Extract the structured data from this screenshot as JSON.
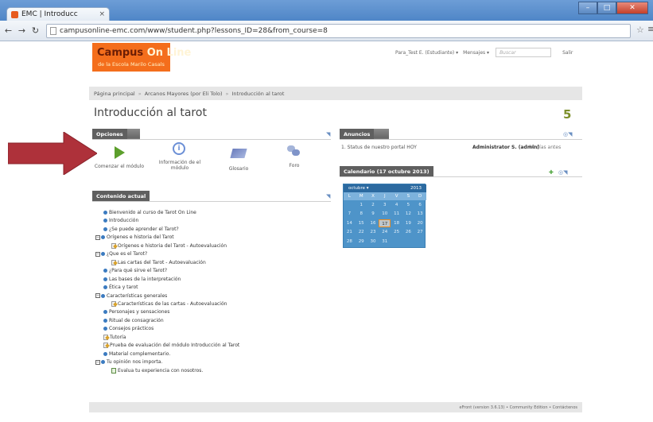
{
  "browser": {
    "tab_title": "EMC | Introducc",
    "url": "campusonline-emc.com/www/student.php?lessons_ID=28&from_course=8"
  },
  "header": {
    "logo_title_a": "Campus",
    "logo_title_b": " On Line",
    "logo_subtitle": "de la Escola Marilo Casals",
    "user": "Para_Test E. (Estudiante) ▾",
    "messages": "Mensajes ▾",
    "search_placeholder": "Buscar",
    "logout": "Salir"
  },
  "breadcrumb": [
    "Página principal",
    "Arcanos Mayores (por Eli Tolo)",
    "Introducción al tarot"
  ],
  "page_title": "Introducción al tarot",
  "options_panel": {
    "title": "Opciones",
    "items": [
      {
        "label": "Comenzar el módulo",
        "icon": "play-icon"
      },
      {
        "label": "Información de el módulo",
        "icon": "info-icon"
      },
      {
        "label": "Glosario",
        "icon": "glossary-icon"
      },
      {
        "label": "Foro",
        "icon": "forum-icon"
      }
    ]
  },
  "content_panel": {
    "title": "Contenido actual",
    "tree": [
      {
        "label": "Bienvenido al curso de Tarot On Line",
        "icon": "bullet",
        "level": 0
      },
      {
        "label": "Introducción",
        "icon": "bullet",
        "level": 0
      },
      {
        "label": "¿Se puede aprender el Tarot?",
        "icon": "bullet",
        "level": 0
      },
      {
        "label": "Orígenes e historia del Tarot",
        "icon": "bullet",
        "level": 0,
        "toggle": "−"
      },
      {
        "label": "Orígenes e historia del Tarot - Autoevaluación",
        "icon": "doc",
        "level": 1
      },
      {
        "label": "¿Que es el Tarot?",
        "icon": "bullet",
        "level": 0,
        "toggle": "−"
      },
      {
        "label": "Las cartas del Tarot - Autoevaluación",
        "icon": "doc",
        "level": 1
      },
      {
        "label": "¿Para qué sirve el Tarot?",
        "icon": "bullet",
        "level": 0
      },
      {
        "label": "Las bases de la interpretación",
        "icon": "bullet",
        "level": 0
      },
      {
        "label": "Ética y tarot",
        "icon": "bullet",
        "level": 0
      },
      {
        "label": "Características generales",
        "icon": "bullet",
        "level": 0,
        "toggle": "−"
      },
      {
        "label": "Características de las cartas - Autoevaluación",
        "icon": "doc",
        "level": 1
      },
      {
        "label": "Personajes y sensaciones",
        "icon": "bullet",
        "level": 0
      },
      {
        "label": "Ritual de consagración",
        "icon": "bullet",
        "level": 0
      },
      {
        "label": "Consejos prácticos",
        "icon": "bullet",
        "level": 0
      },
      {
        "label": "Tutoría",
        "icon": "doc",
        "level": 0
      },
      {
        "label": "Prueba de evaluación del módulo Introducción al Tarot",
        "icon": "doc",
        "level": 0
      },
      {
        "label": "Material complementario.",
        "icon": "bullet",
        "level": 0
      },
      {
        "label": "Tu opinión nos importa.",
        "icon": "bullet",
        "level": 0,
        "toggle": "−"
      },
      {
        "label": "Evalua tu experiencia con nosotros.",
        "icon": "sheet",
        "level": 1
      }
    ]
  },
  "announcements": {
    "title": "Anuncios",
    "item": "1. Status de nuestro portal HOY",
    "author": "Administrator S. (admin)",
    "time": ", 20 días antes"
  },
  "calendar": {
    "title": "Calendario (17 octubre 2013)",
    "month": "octubre ▾",
    "year": "2013",
    "weekdays": [
      "L",
      "M",
      "X",
      "J",
      "V",
      "S",
      "D"
    ],
    "weeks": [
      [
        "",
        "1",
        "2",
        "3",
        "4",
        "5",
        "6"
      ],
      [
        "7",
        "8",
        "9",
        "10",
        "11",
        "12",
        "13"
      ],
      [
        "14",
        "15",
        "16",
        "17",
        "18",
        "19",
        "20"
      ],
      [
        "21",
        "22",
        "23",
        "24",
        "25",
        "26",
        "27"
      ],
      [
        "28",
        "29",
        "30",
        "31",
        "",
        "",
        ""
      ]
    ],
    "today": "17"
  },
  "footer": "eFront (version 3.6.13) • Community Edition • Contáctenos",
  "colors": {
    "accent": "#f46e1c",
    "arrow": "#a8202a",
    "calendar": "#4e94c9"
  }
}
